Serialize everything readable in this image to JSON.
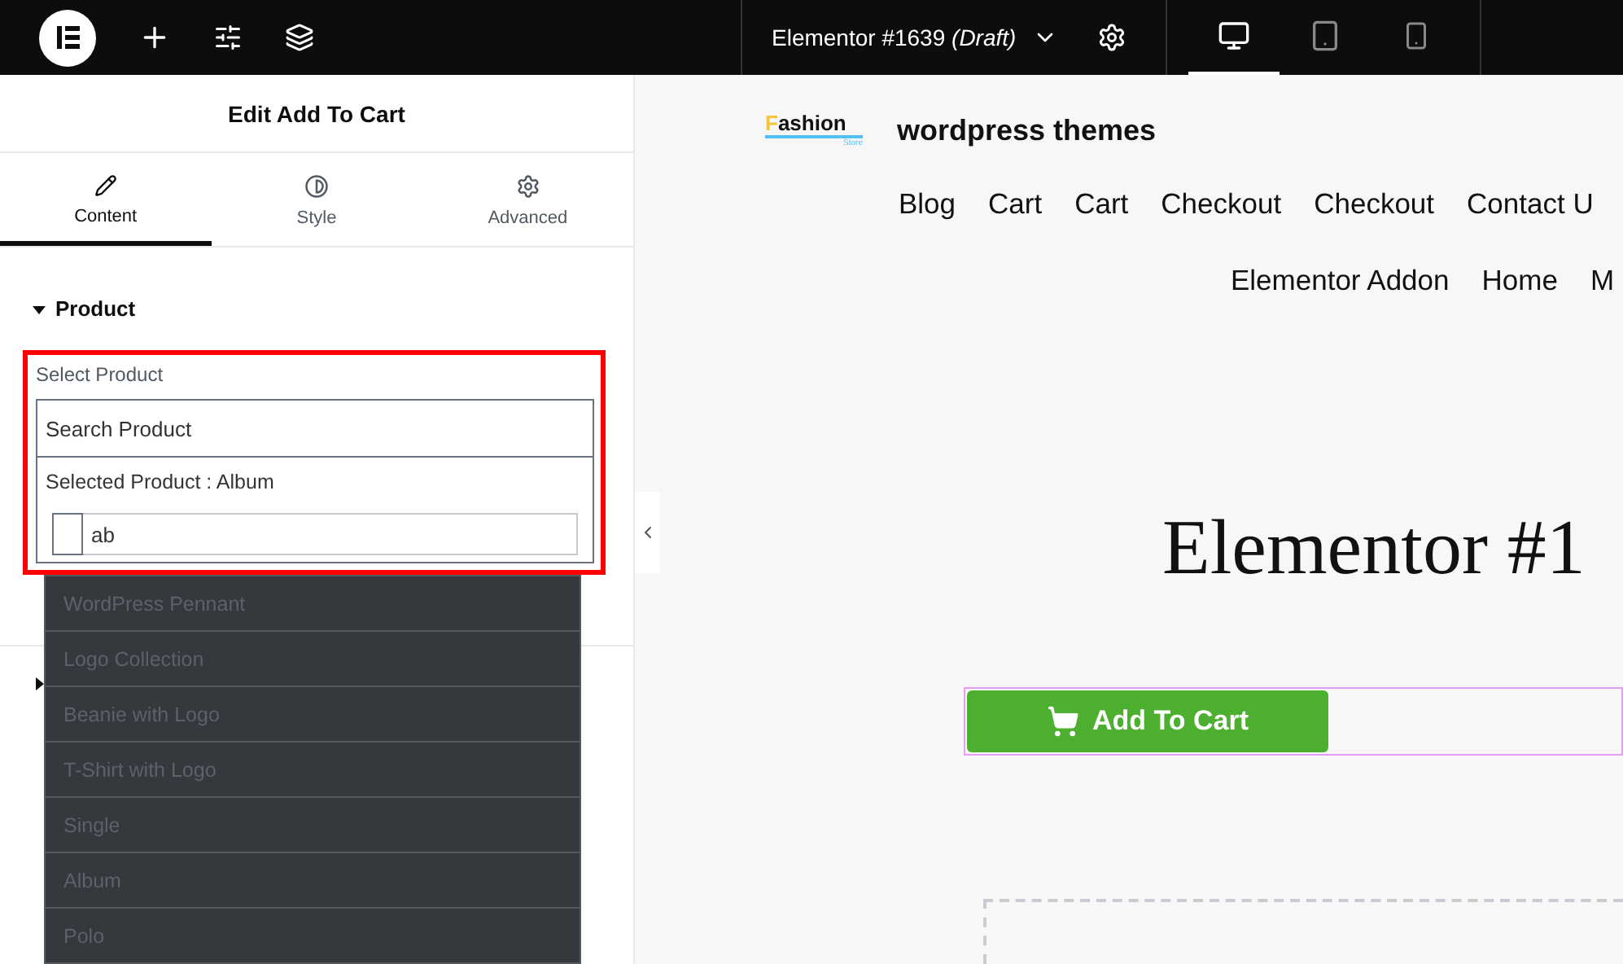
{
  "topbar": {
    "title": "Elementor #1639",
    "status": "(Draft)",
    "devices": [
      {
        "kind": "desktop",
        "selected": true
      },
      {
        "kind": "tablet",
        "selected": false
      },
      {
        "kind": "mobile",
        "selected": false
      }
    ]
  },
  "panel": {
    "title": "Edit Add To Cart",
    "tabs": [
      {
        "label": "Content",
        "kind": "pencil",
        "selected": true
      },
      {
        "label": "Style",
        "kind": "contrast",
        "selected": false
      },
      {
        "label": "Advanced",
        "kind": "gear",
        "selected": false
      }
    ],
    "section": {
      "title": "Product",
      "expanded": true
    },
    "control": {
      "label": "Select Product",
      "placeholder": "Search Product",
      "selected_text": "Selected Product : Album",
      "query": "ab",
      "highlighted": true
    },
    "dropdown": [
      "WordPress Pennant",
      "Logo Collection",
      "Beanie with Logo",
      "T-Shirt with Logo",
      "Single",
      "Album",
      "Polo"
    ]
  },
  "canvas": {
    "logo": {
      "initial": "F",
      "rest": "ashion",
      "sub": "Store"
    },
    "site_title": "wordpress themes",
    "nav_rows": [
      [
        "Blog",
        "Cart",
        "Cart",
        "Checkout",
        "Checkout",
        "Contact U"
      ],
      [
        "Elementor Addon",
        "Home",
        "M"
      ]
    ],
    "heading": "Elementor #1",
    "button": "Add To Cart"
  }
}
